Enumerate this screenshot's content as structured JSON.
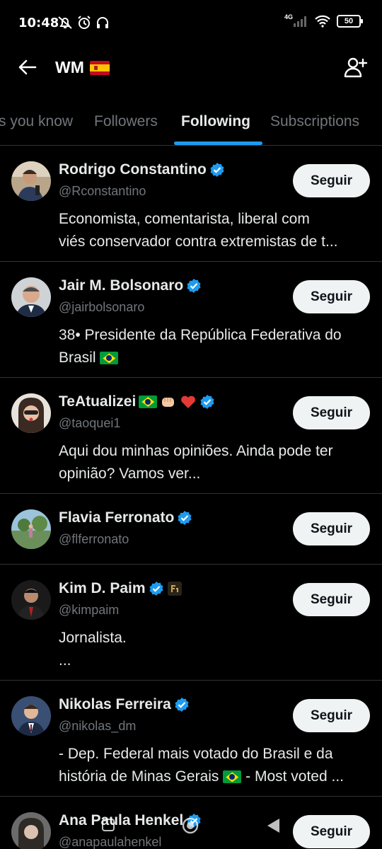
{
  "status_bar": {
    "time": "10:48",
    "network": "4G",
    "battery": "50"
  },
  "header": {
    "title": "WM"
  },
  "tabs": [
    {
      "label": "s you know",
      "active": false
    },
    {
      "label": "Followers",
      "active": false
    },
    {
      "label": "Following",
      "active": true
    },
    {
      "label": "Subscriptions",
      "active": false
    }
  ],
  "colors": {
    "accent": "#1d9bf0",
    "background": "#000000",
    "secondary_text": "#71767b",
    "button_bg": "#eff3f4"
  },
  "follow_label": "Seguir",
  "users": [
    {
      "name": "Rodrigo Constantino",
      "handle": "@Rconstantino",
      "bio": [
        "Economista, comentarista, liberal com",
        "viés conservador contra extremistas de t..."
      ],
      "verified": true
    },
    {
      "name": "Jair M. Bolsonaro",
      "handle": "@jairbolsonaro",
      "bio": [
        "38• Presidente da República Federativa do",
        "Brasil"
      ],
      "verified": true
    },
    {
      "name": "TeAtualizei",
      "handle": "@taoquei1",
      "bio": [
        "Aqui dou minhas opiniões. Ainda pode ter",
        "opinião? Vamos ver..."
      ],
      "verified": true
    },
    {
      "name": "Flavia Ferronato",
      "handle": "@flferronato",
      "bio": [],
      "verified": true
    },
    {
      "name": "Kim D. Paim",
      "handle": "@kimpaim",
      "bio": [
        "Jornalista.",
        "..."
      ],
      "verified": true
    },
    {
      "name": "Nikolas Ferreira",
      "handle": "@nikolas_dm",
      "bio": [
        "- Dep. Federal mais votado do Brasil e da",
        "história de Minas Gerais"
      ],
      "bio_tail": "- Most voted ...",
      "verified": true
    },
    {
      "name": "Ana Paula Henkel",
      "handle": "@anapaulahenkel",
      "bio": [],
      "verified": true
    }
  ]
}
